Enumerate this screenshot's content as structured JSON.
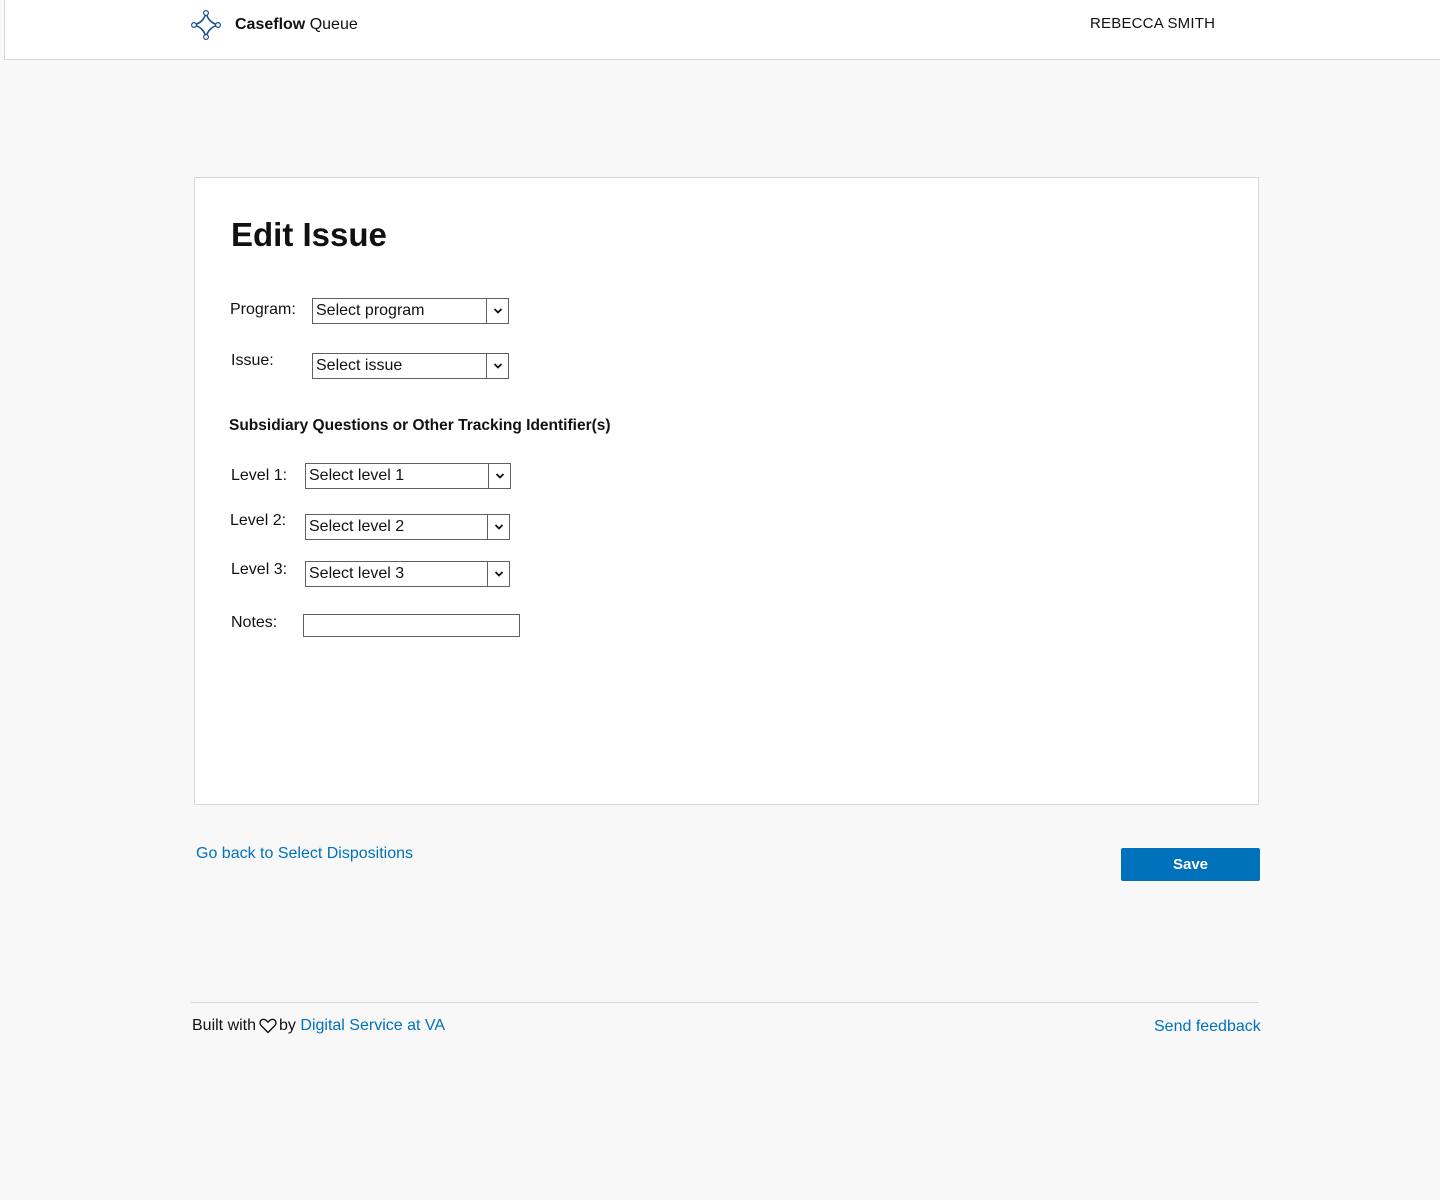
{
  "header": {
    "brand": "Caseflow",
    "product": "Queue",
    "user_name": "REBECCA SMITH"
  },
  "form": {
    "title": "Edit Issue",
    "program": {
      "label": "Program:",
      "value": "Select program"
    },
    "issue": {
      "label": "Issue:",
      "value": "Select issue"
    },
    "subsidiary_title": "Subsidiary Questions or Other Tracking Identifier(s)",
    "levels": [
      {
        "label": "Level 1:",
        "value": "Select level 1"
      },
      {
        "label": "Level 2:",
        "value": "Select level 2"
      },
      {
        "label": "Level 3:",
        "value": "Select level 3"
      }
    ],
    "notes": {
      "label": "Notes:",
      "value": ""
    }
  },
  "actions": {
    "back_link": "Go back to Select Dispositions",
    "save_label": "Save"
  },
  "footer": {
    "built_with": "Built with",
    "by": "by",
    "org_link": "Digital Service at VA",
    "feedback_link": "Send feedback"
  },
  "colors": {
    "link": "#0071bb",
    "primary_button": "#0071bb",
    "page_background": "#f8f8f8",
    "border": "#d6d7d9",
    "logo": "#1d4f91"
  },
  "icons": {
    "logo": "caseflow-logo-icon",
    "dropdown": "chevron-down-icon",
    "heart": "heart-icon"
  }
}
